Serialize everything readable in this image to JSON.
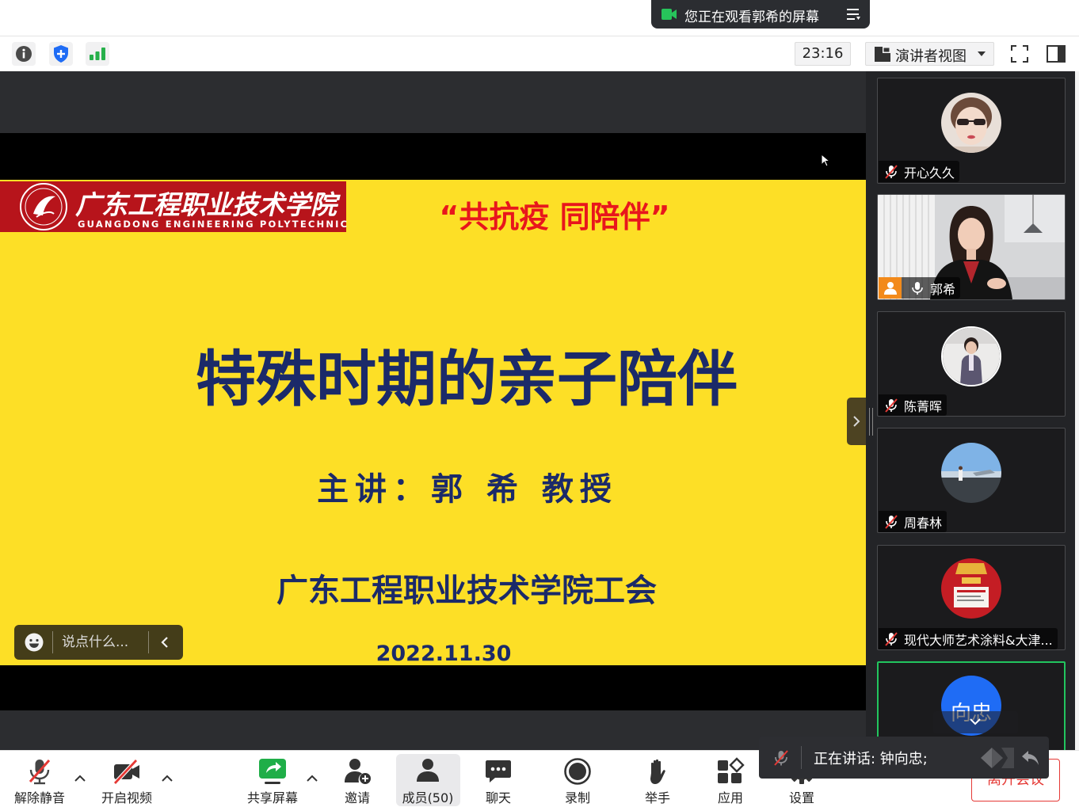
{
  "banner": {
    "text": "您正在观看郭希的屏幕",
    "icon": "screen-share-icon",
    "menu_icon": "list-menu-icon"
  },
  "topbar": {
    "left_icons": [
      "info-icon",
      "shield-icon",
      "signal-bars-icon"
    ],
    "time": "23:16",
    "view_mode": "演讲者视图",
    "right_icons": [
      "fullscreen-icon",
      "sidebar-toggle-icon"
    ]
  },
  "slide": {
    "logo_cn": "广东工程职业技术学院",
    "logo_en": "GUANGDONG ENGINEERING POLYTECHNIC",
    "slogan": "“共抗疫  同陪伴”",
    "title": "特殊时期的亲子陪伴",
    "speaker": "主讲：郭 希 教授",
    "org": "广东工程职业技术学院工会",
    "date": "2022.11.30",
    "colors": {
      "background": "#fddf26",
      "text": "#1b2a69",
      "slogan": "#e8161c",
      "logo": "#b7141b"
    }
  },
  "chat": {
    "placeholder": "说点什么...",
    "emoji_icon": "emoji-icon",
    "collapse_icon": "chevron-left-icon"
  },
  "participants": [
    {
      "name": "开心久久",
      "mic_icon": "mic-muted-icon"
    },
    {
      "name": "郭希",
      "mic_icon": "mic-icon",
      "badge_icon": "host-person-icon"
    },
    {
      "name": "陈菁晖",
      "mic_icon": "mic-muted-icon"
    },
    {
      "name": "周春林",
      "mic_icon": "mic-muted-icon"
    },
    {
      "name": "现代大师艺术涂料&大津...",
      "mic_icon": "mic-muted-icon"
    },
    {
      "avatar_text": "向忠",
      "avatar_color": "#1f6cf5",
      "highlight_color": "#22c55e"
    }
  ],
  "speaking": {
    "text": "正在讲话: 钟向忠;",
    "mic_icon": "mic-muted-icon"
  },
  "toolbar": {
    "items": [
      {
        "label": "解除静音",
        "icon": "mic-muted-icon"
      },
      {
        "label": "开启视频",
        "icon": "video-off-icon"
      },
      {
        "label": "共享屏幕",
        "icon": "share-screen-icon"
      },
      {
        "label": "邀请",
        "icon": "invite-icon"
      },
      {
        "label": "成员(50)",
        "icon": "members-icon"
      },
      {
        "label": "聊天",
        "icon": "chat-icon"
      },
      {
        "label": "录制",
        "icon": "record-icon"
      },
      {
        "label": "举手",
        "icon": "raise-hand-icon"
      },
      {
        "label": "应用",
        "icon": "apps-icon"
      },
      {
        "label": "设置",
        "icon": "settings-icon"
      }
    ],
    "leave_label": "离开会议",
    "danger_color": "#e53935",
    "share_color": "#1fae48"
  }
}
